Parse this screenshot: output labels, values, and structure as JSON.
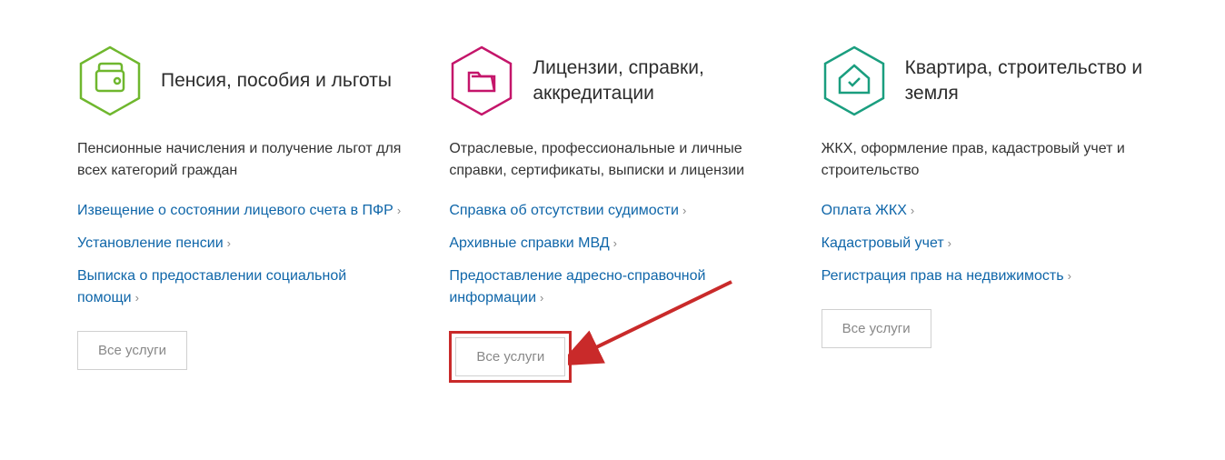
{
  "cards": [
    {
      "title": "Пенсия, пособия и льготы",
      "description": "Пенсионные начисления и получение льгот для всех категорий граждан",
      "links": [
        "Извещение о состоянии лицевого счета в ПФР",
        "Установление пенсии",
        "Выписка о предоставлении социальной помощи"
      ],
      "button_label": "Все услуги",
      "icon_color": "#6fb72e"
    },
    {
      "title": "Лицензии, справки, аккредитации",
      "description": "Отраслевые, профессиональные и личные справки, сертификаты, выписки и лицензии",
      "links": [
        "Справка об отсутствии судимости",
        "Архивные справки МВД",
        "Предоставление адресно-справочной информации"
      ],
      "button_label": "Все услуги",
      "icon_color": "#c4156a"
    },
    {
      "title": "Квартира, строительство и земля",
      "description": "ЖКХ, оформление прав, кадастровый учет и строительство",
      "links": [
        "Оплата ЖКХ",
        "Кадастровый учет",
        "Регистрация прав на недвижимость"
      ],
      "button_label": "Все услуги",
      "icon_color": "#1a9e7f"
    }
  ]
}
